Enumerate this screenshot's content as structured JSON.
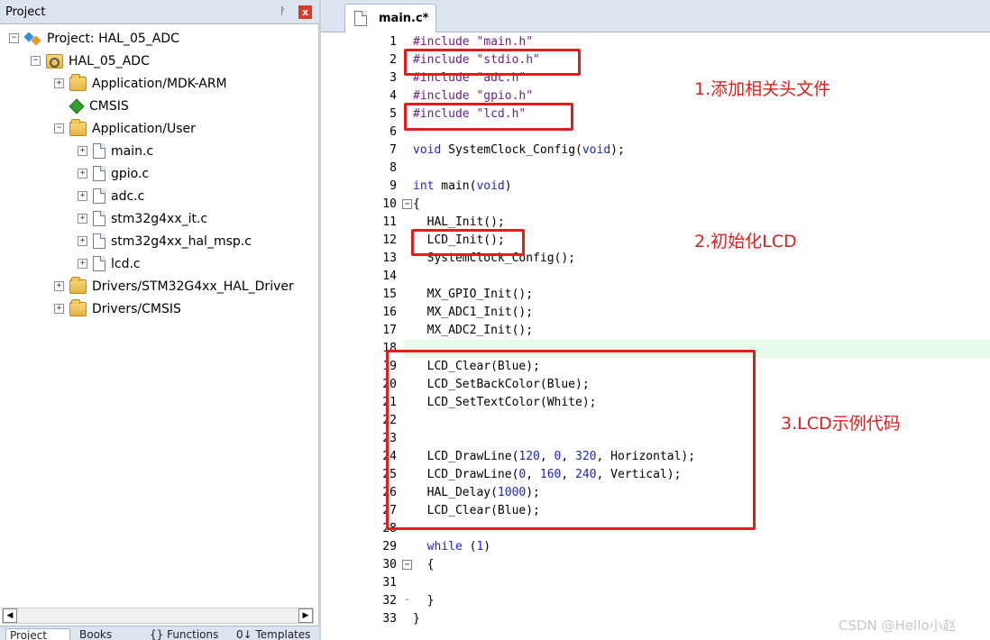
{
  "project_panel": {
    "title": "Project",
    "pin_glyph": "ᚹ",
    "close_glyph": "x",
    "tree": [
      {
        "label": "Project: HAL_05_ADC",
        "icon": "project-icon",
        "toggle": "−",
        "depth": 0
      },
      {
        "label": "HAL_05_ADC",
        "icon": "target-icon",
        "toggle": "−",
        "depth": 1
      },
      {
        "label": "Application/MDK-ARM",
        "icon": "folder-icon",
        "toggle": "+",
        "depth": 2
      },
      {
        "label": "CMSIS",
        "icon": "cmsis-icon",
        "toggle": "",
        "depth": 2
      },
      {
        "label": "Application/User",
        "icon": "folder-icon",
        "toggle": "−",
        "depth": 2
      },
      {
        "label": "main.c",
        "icon": "file-icon",
        "toggle": "+",
        "depth": 3
      },
      {
        "label": "gpio.c",
        "icon": "file-icon",
        "toggle": "+",
        "depth": 3
      },
      {
        "label": "adc.c",
        "icon": "file-icon",
        "toggle": "+",
        "depth": 3
      },
      {
        "label": "stm32g4xx_it.c",
        "icon": "file-icon",
        "toggle": "+",
        "depth": 3
      },
      {
        "label": "stm32g4xx_hal_msp.c",
        "icon": "file-icon",
        "toggle": "+",
        "depth": 3
      },
      {
        "label": "lcd.c",
        "icon": "file-icon",
        "toggle": "+",
        "depth": 3
      },
      {
        "label": "Drivers/STM32G4xx_HAL_Driver",
        "icon": "folder-icon",
        "toggle": "+",
        "depth": 2
      },
      {
        "label": "Drivers/CMSIS",
        "icon": "folder-icon",
        "toggle": "+",
        "depth": 2
      }
    ],
    "scroll_left_glyph": "◀",
    "scroll_right_glyph": "▶",
    "bottom_tabs": [
      "Project",
      "Books",
      "{} Functions",
      "0↓ Templates"
    ]
  },
  "editor": {
    "active_tab": "main.c*",
    "lines": [
      {
        "n": "1",
        "text": "#include \"main.h\"",
        "kind": "pre"
      },
      {
        "n": "2",
        "text": "#include \"stdio.h\"",
        "kind": "pre"
      },
      {
        "n": "3",
        "text": "#include \"adc.h\"",
        "kind": "pre"
      },
      {
        "n": "4",
        "text": "#include \"gpio.h\"",
        "kind": "pre"
      },
      {
        "n": "5",
        "text": "#include \"lcd.h\"",
        "kind": "pre"
      },
      {
        "n": "6",
        "text": "",
        "kind": "plain"
      },
      {
        "n": "7",
        "text": "void SystemClock_Config(void);",
        "kind": "plain"
      },
      {
        "n": "8",
        "text": "",
        "kind": "plain"
      },
      {
        "n": "9",
        "text": "int main(void)",
        "kind": "plain"
      },
      {
        "n": "10",
        "text": "{",
        "kind": "plain",
        "fold": "−"
      },
      {
        "n": "11",
        "text": "  HAL_Init();",
        "kind": "plain"
      },
      {
        "n": "12",
        "text": "  LCD_Init();",
        "kind": "plain"
      },
      {
        "n": "13",
        "text": "  SystemClock_Config();",
        "kind": "plain"
      },
      {
        "n": "14",
        "text": "",
        "kind": "plain"
      },
      {
        "n": "15",
        "text": "  MX_GPIO_Init();",
        "kind": "plain"
      },
      {
        "n": "16",
        "text": "  MX_ADC1_Init();",
        "kind": "plain"
      },
      {
        "n": "17",
        "text": "  MX_ADC2_Init();",
        "kind": "plain"
      },
      {
        "n": "18",
        "text": "",
        "kind": "plain"
      },
      {
        "n": "19",
        "text": "  LCD_Clear(Blue);",
        "kind": "plain"
      },
      {
        "n": "20",
        "text": "  LCD_SetBackColor(Blue);",
        "kind": "plain"
      },
      {
        "n": "21",
        "text": "  LCD_SetTextColor(White);",
        "kind": "plain"
      },
      {
        "n": "22",
        "text": "",
        "kind": "plain"
      },
      {
        "n": "23",
        "text": "",
        "kind": "plain"
      },
      {
        "n": "24",
        "text": "  LCD_DrawLine(120, 0, 320, Horizontal);",
        "kind": "plain"
      },
      {
        "n": "25",
        "text": "  LCD_DrawLine(0, 160, 240, Vertical);",
        "kind": "plain"
      },
      {
        "n": "26",
        "text": "  HAL_Delay(1000);",
        "kind": "plain"
      },
      {
        "n": "27",
        "text": "  LCD_Clear(Blue);",
        "kind": "plain"
      },
      {
        "n": "28",
        "text": "",
        "kind": "plain"
      },
      {
        "n": "29",
        "text": "  while (1)",
        "kind": "plain"
      },
      {
        "n": "30",
        "text": "  {",
        "kind": "plain",
        "fold": "−"
      },
      {
        "n": "31",
        "text": "",
        "kind": "plain"
      },
      {
        "n": "32",
        "text": "  }",
        "kind": "plain",
        "fold": "-"
      },
      {
        "n": "33",
        "text": "}",
        "kind": "plain"
      }
    ],
    "scroll_left_glyph": "<"
  },
  "annotations": {
    "note1": "1.添加相关头文件",
    "note2": "2.初始化LCD",
    "note3": "3.LCD示例代码",
    "color": "#e21d1d"
  },
  "watermark": "CSDN @Hello小赵"
}
